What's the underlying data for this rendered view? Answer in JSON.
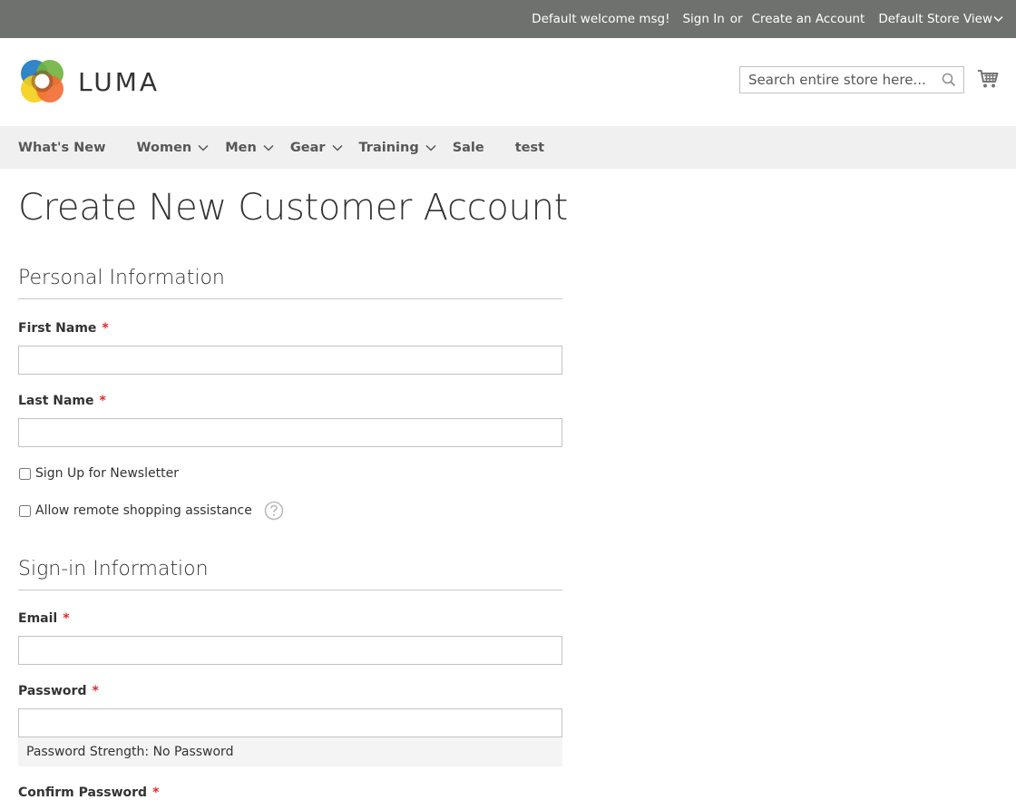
{
  "top_panel": {
    "welcome": "Default welcome msg!",
    "sign_in": "Sign In",
    "or": "or",
    "create_account": "Create an Account",
    "store_view": "Default Store View"
  },
  "header": {
    "logo_text": "LUMA",
    "search_placeholder": "Search entire store here...",
    "search_value": ""
  },
  "nav": {
    "items": [
      {
        "label": "What's New",
        "has_submenu": false
      },
      {
        "label": "Women",
        "has_submenu": true
      },
      {
        "label": "Men",
        "has_submenu": true
      },
      {
        "label": "Gear",
        "has_submenu": true
      },
      {
        "label": "Training",
        "has_submenu": true
      },
      {
        "label": "Sale",
        "has_submenu": false
      },
      {
        "label": "test",
        "has_submenu": false
      }
    ]
  },
  "page": {
    "title": "Create New Customer Account",
    "personal": {
      "legend": "Personal Information",
      "first_name_label": "First Name",
      "first_name_value": "",
      "last_name_label": "Last Name",
      "last_name_value": "",
      "newsletter_label": "Sign Up for Newsletter",
      "newsletter_checked": false,
      "remote_assist_label": "Allow remote shopping assistance",
      "remote_assist_checked": false
    },
    "signin": {
      "legend": "Sign-in Information",
      "email_label": "Email",
      "email_value": "",
      "password_label": "Password",
      "password_value": "",
      "password_strength": "Password Strength: No Password",
      "confirm_password_label": "Confirm Password"
    },
    "required_marker": "*"
  },
  "colors": {
    "top_panel_bg": "#6e716e",
    "nav_bg": "#f0f0f0",
    "required": "#e02b27",
    "border": "#c2c2c2"
  },
  "icons": {
    "search": "search-icon",
    "cart": "cart-icon",
    "help": "help-icon",
    "chevron": "chevron-down-icon"
  }
}
